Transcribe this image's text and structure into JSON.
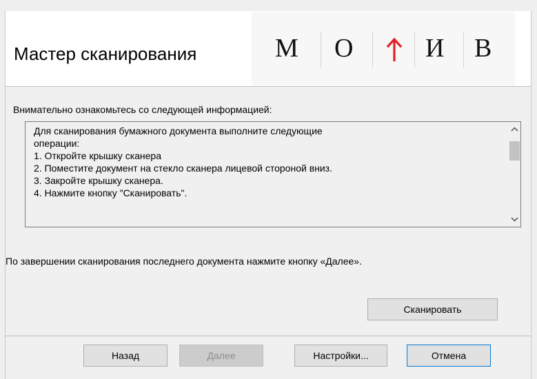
{
  "window": {
    "header_title": "Мастер сканирования",
    "logo": {
      "letters": [
        "М",
        "О",
        "Т",
        "И",
        "В"
      ],
      "accent_color": "#e31e24"
    }
  },
  "content": {
    "notice": "Внимательно ознакомьтесь со следующей информацией:",
    "instructions": [
      "Для сканирования бумажного документа выполните следующие",
      "операции:",
      "1. Откройте крышку сканера",
      "2. Поместите документ на стекло сканера лицевой стороной вниз.",
      "3. Закройте крышку сканера.",
      "4. Нажмите кнопку \"Сканировать\"."
    ],
    "finish_text": "По завершении сканирования последнего документа нажмите кнопку «Далее».",
    "scan_button": "Сканировать"
  },
  "footer": {
    "back_button": "Назад",
    "next_button": "Далее",
    "settings_button": "Настройки...",
    "cancel_button": "Отмена"
  },
  "icons": {
    "scroll_up": "chevron-up-icon",
    "scroll_down": "chevron-down-icon",
    "logo_arrow": "arrow-up-icon"
  }
}
